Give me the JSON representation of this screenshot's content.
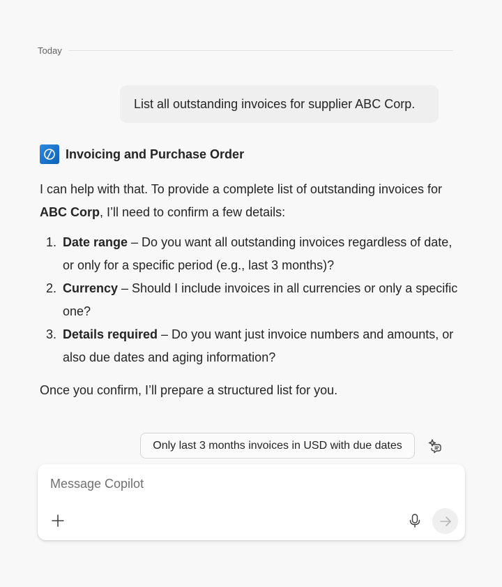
{
  "divider": {
    "label": "Today"
  },
  "user_message": {
    "text": "List all outstanding invoices for supplier ABC Corp."
  },
  "bot": {
    "name": "Invoicing and Purchase Order",
    "icon": "agent-icon",
    "intro_prefix": "I can help with that. To provide a complete list of outstanding invoices for ",
    "intro_bold": "ABC Corp",
    "intro_suffix": ", I’ll need to confirm a few details:",
    "items": [
      {
        "num": "1.",
        "bold": "Date range",
        "text": " – Do you want all outstanding invoices regardless of date, or only for a specific period (e.g., last 3 months)?"
      },
      {
        "num": "2.",
        "bold": "Currency",
        "text": " – Should I include invoices in all currencies or only a specific one?"
      },
      {
        "num": "3.",
        "bold": "Details required",
        "text": " – Do you want just invoice numbers and amounts, or also due dates and aging information?"
      }
    ],
    "outro": "Once you confirm, I’ll prepare a structured list for you."
  },
  "suggestion": {
    "label": "Only last 3 months invoices in USD with due dates",
    "icon": "sparkle-prompt-icon"
  },
  "composer": {
    "placeholder": "Message Copilot",
    "value": "",
    "add_icon": "plus-icon",
    "mic_icon": "microphone-icon",
    "send_icon": "arrow-right-icon"
  },
  "colors": {
    "accent": "#1a73d1",
    "background": "#f8f8f8",
    "bubble": "#efefef"
  }
}
